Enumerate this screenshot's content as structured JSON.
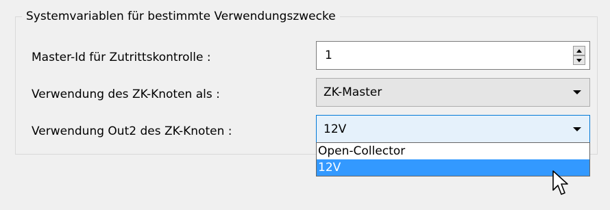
{
  "group": {
    "title": "Systemvariablen für bestimmte Verwendungszwecke"
  },
  "rows": {
    "master_id": {
      "label": "Master-Id für Zutrittskontrolle :",
      "value": "1"
    },
    "zk_knoten": {
      "label": "Verwendung des ZK-Knoten als :",
      "value": "ZK-Master"
    },
    "out2": {
      "label": "Verwendung Out2 des ZK-Knoten :",
      "value": "12V",
      "options": [
        "Open-Collector",
        "12V"
      ],
      "selected_index": 1
    }
  },
  "colors": {
    "highlight": "#3399ff",
    "focus_border": "#0078d7"
  },
  "icons": {
    "spin_up": "caret-up-icon",
    "spin_down": "caret-down-icon",
    "dropdown_arrow": "chevron-down-icon",
    "cursor": "mouse-pointer-icon"
  }
}
